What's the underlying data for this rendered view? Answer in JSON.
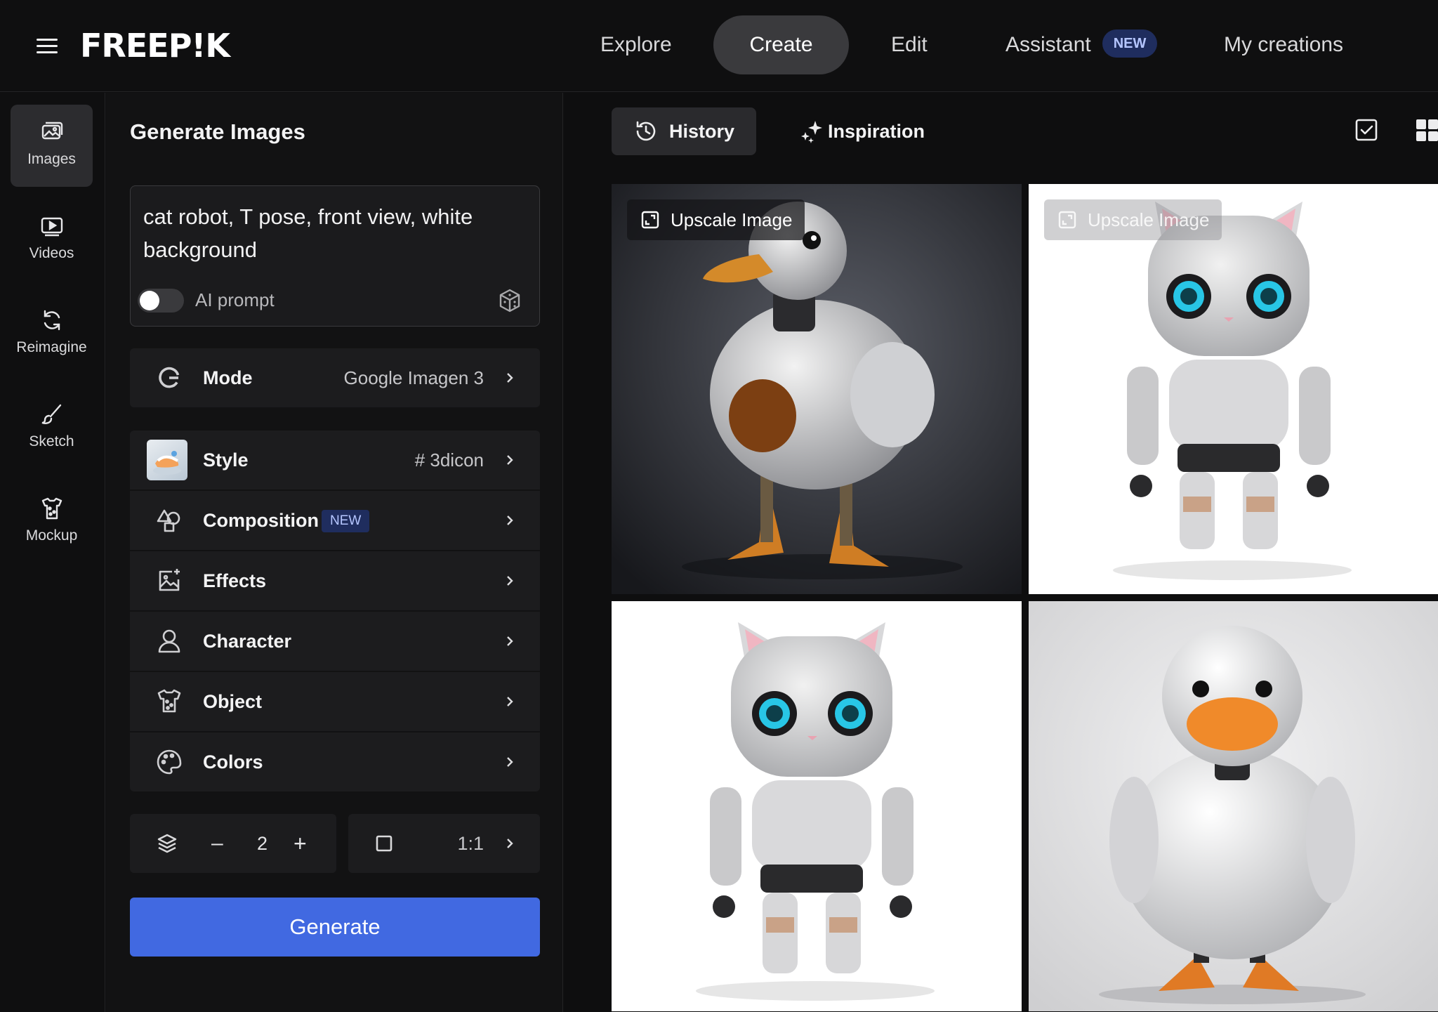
{
  "brand": {
    "logo": "FREEP!K"
  },
  "nav": {
    "explore": "Explore",
    "create": "Create",
    "edit": "Edit",
    "assistant": "Assistant",
    "assistant_badge": "NEW",
    "my_creations": "My creations"
  },
  "rail": {
    "items": [
      {
        "label": "Images",
        "icon": "images-icon",
        "active": true
      },
      {
        "label": "Videos",
        "icon": "video-icon"
      },
      {
        "label": "Reimagine",
        "icon": "refresh-icon"
      },
      {
        "label": "Sketch",
        "icon": "brush-icon"
      },
      {
        "label": "Mockup",
        "icon": "mockup-icon"
      }
    ]
  },
  "panel": {
    "title": "Generate Images",
    "prompt": "cat robot, T pose, front view, white background",
    "ai_prompt_label": "AI prompt",
    "ai_prompt_enabled": false,
    "mode": {
      "label": "Mode",
      "value": "Google Imagen 3"
    },
    "options": [
      {
        "label": "Style",
        "value": "# 3dicon"
      },
      {
        "label": "Composition",
        "badge": "NEW"
      },
      {
        "label": "Effects"
      },
      {
        "label": "Character"
      },
      {
        "label": "Object"
      },
      {
        "label": "Colors"
      }
    ],
    "quantity": "2",
    "aspect_ratio": "1:1",
    "generate_label": "Generate"
  },
  "gallery": {
    "tabs": {
      "history": "History",
      "inspiration": "Inspiration"
    },
    "upscale_label": "Upscale Image",
    "images": [
      {
        "subject": "robot duck, dark background"
      },
      {
        "subject": "cat robot, white background"
      },
      {
        "subject": "cat robot, white background"
      },
      {
        "subject": "robot duck, light background"
      }
    ]
  },
  "colors": {
    "accent": "#4169e1",
    "badge_bg": "#1f2d5e",
    "badge_text": "#b5c6ff",
    "active_nav": "#3a3a3d"
  }
}
